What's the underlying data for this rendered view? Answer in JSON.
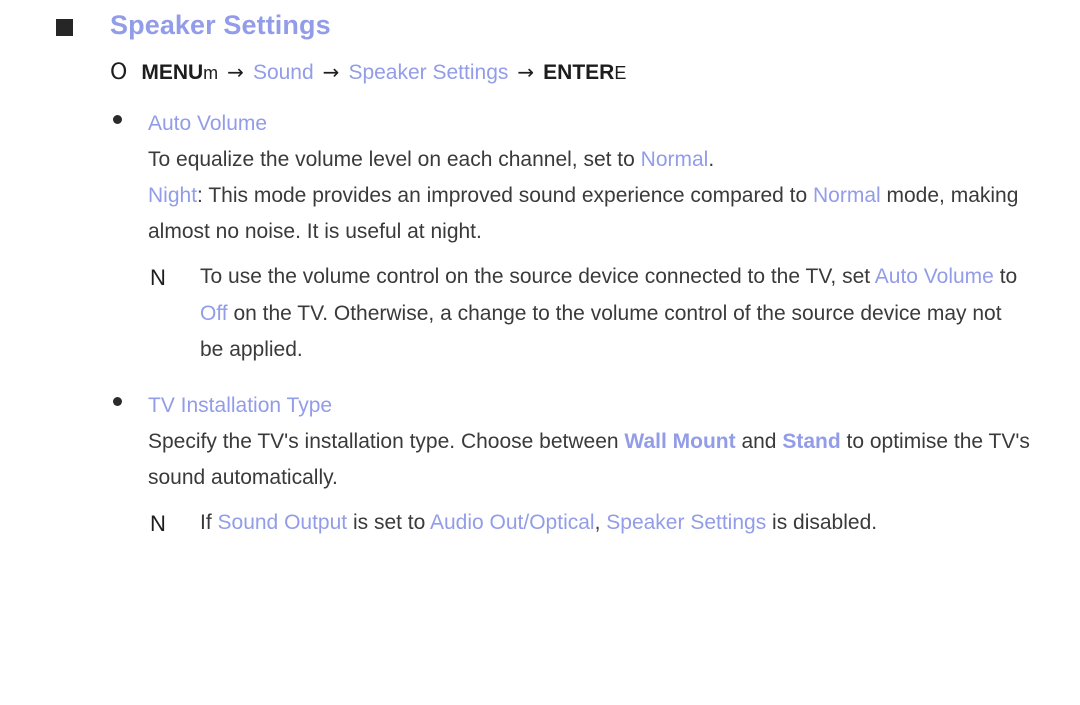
{
  "page": {
    "title": "Speaker Settings",
    "accent_color": "#929ce8",
    "text_color": "#3a3a3a",
    "background_color": "#ffffff"
  },
  "menu_path": {
    "circle_icon": "O",
    "menu_label": "MENU",
    "menu_key_icon": "m",
    "arrow": "→",
    "step_sound": "Sound",
    "step_speaker_settings": "Speaker Settings",
    "enter_label": "ENTER",
    "enter_key_icon": "E"
  },
  "sections": [
    {
      "heading": "Auto Volume",
      "paragraphs": [
        {
          "parts": [
            {
              "text": "To equalize the volume level on each channel, set to ",
              "style": "normal"
            },
            {
              "text": "Normal",
              "style": "accent"
            },
            {
              "text": ".",
              "style": "normal"
            }
          ]
        },
        {
          "parts": [
            {
              "text": "Night",
              "style": "accent"
            },
            {
              "text": ": This mode provides an improved sound experience compared to ",
              "style": "normal"
            },
            {
              "text": "Normal",
              "style": "accent"
            },
            {
              "text": " mode, making almost no noise. It is useful at night.",
              "style": "normal"
            }
          ]
        }
      ],
      "notes": [
        {
          "marker": "N",
          "parts": [
            {
              "text": "To use the volume control on the source device connected to the TV, set ",
              "style": "normal"
            },
            {
              "text": "Auto Volume",
              "style": "accent"
            },
            {
              "text": " to ",
              "style": "normal"
            },
            {
              "text": "Off",
              "style": "accent"
            },
            {
              "text": " on the TV. Otherwise, a change to the volume control of the source device may not be applied.",
              "style": "normal"
            }
          ]
        }
      ]
    },
    {
      "heading": "TV Installation Type",
      "paragraphs": [
        {
          "parts": [
            {
              "text": "Specify the TV's installation type. Choose between ",
              "style": "normal"
            },
            {
              "text": "Wall Mount",
              "style": "accent-bold"
            },
            {
              "text": " and ",
              "style": "normal"
            },
            {
              "text": "Stand",
              "style": "accent-bold"
            },
            {
              "text": " to optimise the TV's sound automatically.",
              "style": "normal"
            }
          ]
        }
      ],
      "notes": [
        {
          "marker": "N",
          "parts": [
            {
              "text": "If ",
              "style": "normal"
            },
            {
              "text": "Sound Output",
              "style": "accent"
            },
            {
              "text": " is set to ",
              "style": "normal"
            },
            {
              "text": "Audio Out/Optical",
              "style": "accent"
            },
            {
              "text": ", ",
              "style": "normal"
            },
            {
              "text": "Speaker Settings",
              "style": "accent"
            },
            {
              "text": " is disabled.",
              "style": "normal"
            }
          ]
        }
      ]
    }
  ]
}
